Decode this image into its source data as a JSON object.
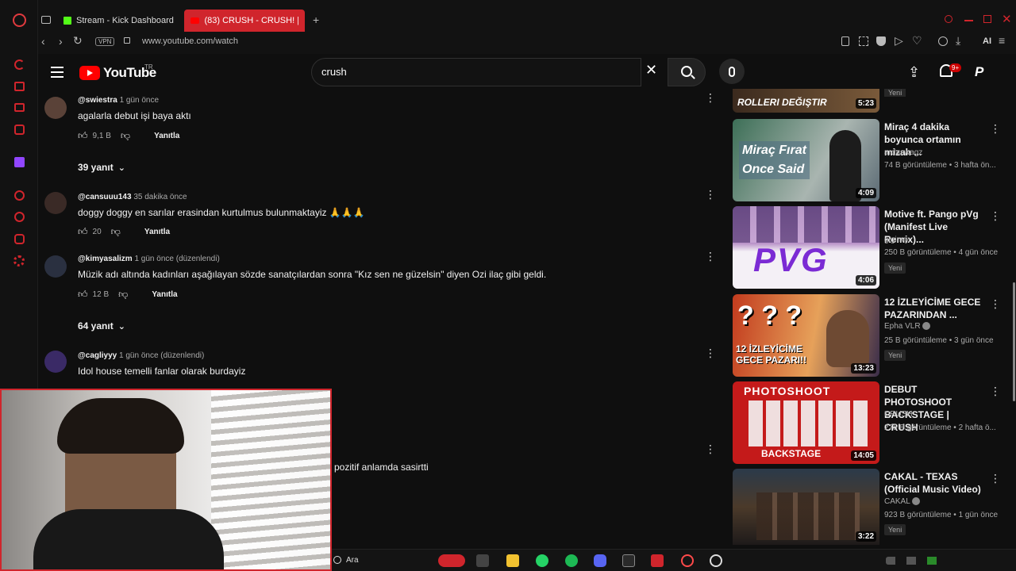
{
  "browser": {
    "tabs": [
      {
        "label": "Stream - Kick Dashboard"
      },
      {
        "label": "(83) CRUSH - CRUSH! | Off"
      }
    ],
    "address": "www.youtube.com/watch",
    "vpn_label": "VPN",
    "ai_label": "AI"
  },
  "youtube": {
    "logo_text": "YouTube",
    "region": "TR",
    "search_value": "crush",
    "notif_count": "9+"
  },
  "comments": [
    {
      "author": "@swiestra",
      "time": "1 gün önce",
      "text": "agalarla debut işi baya aktı",
      "likes": "9,1 B",
      "reply_label": "Yanıtla"
    },
    {
      "author": "@cansuuu143",
      "time": "35 dakika önce",
      "text": "doggy doggy en sarılar erasindan kurtulmus bulunmaktayiz 🙏🙏🙏",
      "likes": "20",
      "reply_label": "Yanıtla"
    },
    {
      "author": "@kimyasalizm",
      "time": "1 gün önce (düzenlendi)",
      "text": "Müzik adı altında kadınları aşağılayan sözde sanatçılardan sonra \"Kız sen ne güzelsin\" diyen Ozi ilaç gibi geldi.",
      "likes": "12 B",
      "reply_label": "Yanıtla"
    },
    {
      "author": "@cagliyyy",
      "time": "1 gün önce (düzenlendi)",
      "text": "Idol house temelli fanlar olarak burdayiz"
    },
    {
      "text": "pozitif anlamda sasirtti"
    }
  ],
  "reply_toggles": [
    "39 yanıt",
    "64 yanıt"
  ],
  "recommendations": [
    {
      "title": "",
      "thumb_text": "ROLLERI DEĞIŞTIR",
      "duration": "5:23",
      "badge": "Yeni"
    },
    {
      "title": "Miraç 4 dakika boyunca ortamın mizah ...",
      "channel": "ardaswagz",
      "views": "74 B görüntüleme",
      "age": "3 hafta ön...",
      "duration": "4:09",
      "thumb_text": "Miraç Fırat\nOnce Said",
      "verified": false
    },
    {
      "title": "Motive ft. Pango pVg (Manifest Live Remix)...",
      "channel": "giginvy",
      "views": "250 B görüntüleme",
      "age": "4 gün önce",
      "duration": "4:06",
      "thumb_text": "PVG",
      "badge": "Yeni",
      "verified": false
    },
    {
      "title": "12 İZLEYİCİME GECE PAZARINDAN ...",
      "channel": "Epha VLR",
      "views": "25 B görüntüleme",
      "age": "3 gün önce",
      "duration": "13:23",
      "thumb_text": "12 İZLEYİCİME GECE PAZARI!!",
      "badge": "Yeni",
      "verified": true
    },
    {
      "title": "DEBUT PHOTOSHOOT BACKSTAGE | CRUSH",
      "channel": "CRUSH",
      "views": "275 B görüntüleme",
      "age": "2 hafta ö...",
      "duration": "14:05",
      "thumb_text": "PHOTOSHOOT",
      "thumb_text2": "BACKSTAGE",
      "verified": false
    },
    {
      "title": "CAKAL - TEXAS (Official Music Video)",
      "channel": "CAKAL",
      "views": "923 B görüntüleme",
      "age": "1 gün önce",
      "duration": "3:22",
      "badge": "Yeni",
      "verified": true
    }
  ],
  "taskbar": {
    "search_label": "Ara"
  },
  "colors": {
    "accent": "#d0252c",
    "bg": "#0f0f0f",
    "text": "#f1f1f1",
    "muted": "#aaaaaa"
  }
}
